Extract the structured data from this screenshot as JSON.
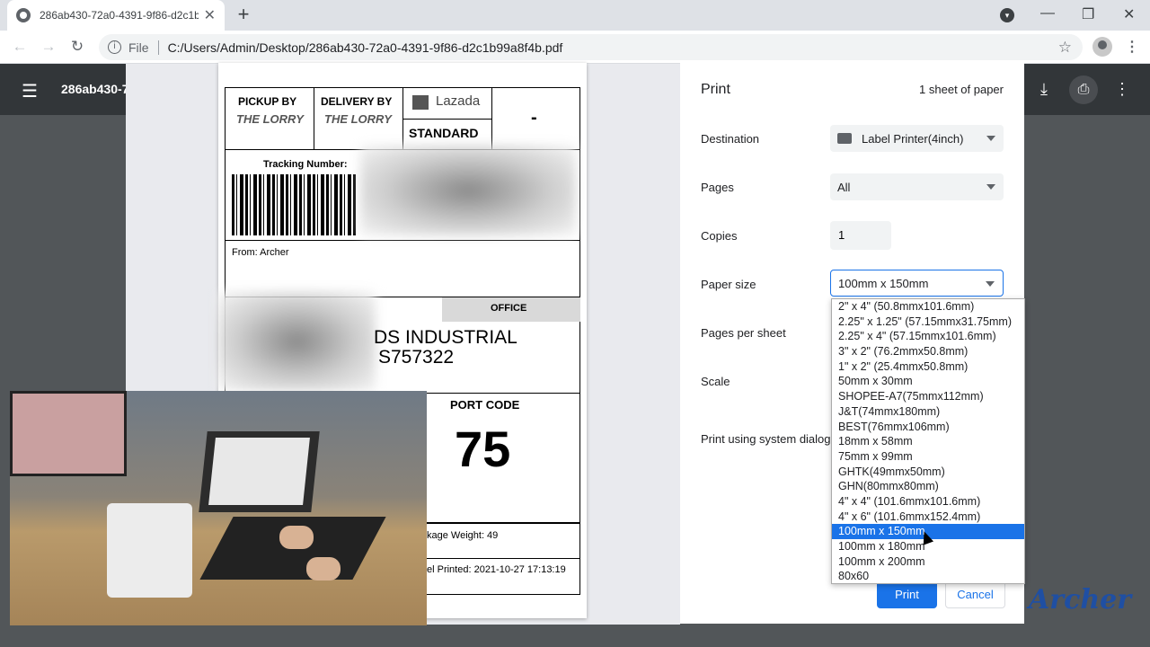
{
  "browser": {
    "tab_title": "286ab430-72a0-4391-9f86-d2c1b99a8f4b.pdf",
    "address_prefix": "File",
    "address": "C:/Users/Admin/Desktop/286ab430-72a0-4391-9f86-d2c1b99a8f4b.pdf"
  },
  "pdf_viewer": {
    "filename": "286ab430-7"
  },
  "label": {
    "pickup_by": "PICKUP BY",
    "delivery_by": "DELIVERY BY",
    "lorry_logo": "THE LORRY",
    "lazada": "Lazada",
    "standard": "STANDARD",
    "dash": "-",
    "tracking": "Tracking Number:",
    "from": "From: Archer",
    "office": "OFFICE",
    "addr1": "DS INDUSTRIAL",
    "addr2": "S757322",
    "port_code_label": "PORT CODE",
    "port_code": "75",
    "weight": "kage Weight: 49",
    "printed": "el Printed: 2021-10-27 17:13:19"
  },
  "dialog": {
    "title": "Print",
    "sheets": "1 sheet of paper",
    "destination_label": "Destination",
    "destination": "Label Printer(4inch)",
    "pages_label": "Pages",
    "pages": "All",
    "copies_label": "Copies",
    "copies": "1",
    "paper_label": "Paper size",
    "paper": "100mm x 150mm",
    "pps_label": "Pages per sheet",
    "scale_label": "Scale",
    "system_label": "Print using system dialog",
    "print_btn": "Print",
    "cancel_btn": "Cancel"
  },
  "paper_options": [
    "2\" x 4\" (50.8mmx101.6mm)",
    "2.25\" x 1.25\" (57.15mmx31.75mm)",
    "2.25\" x 4\" (57.15mmx101.6mm)",
    "3\" x 2\" (76.2mmx50.8mm)",
    "1\" x 2\" (25.4mmx50.8mm)",
    "50mm x 30mm",
    "SHOPEE-A7(75mmx112mm)",
    "J&T(74mmx180mm)",
    "BEST(76mmx106mm)",
    "18mm x 58mm",
    "75mm x 99mm",
    "GHTK(49mmx50mm)",
    "GHN(80mmx80mm)",
    "4\" x 4\" (101.6mmx101.6mm)",
    "4\" x 6\" (101.6mmx152.4mm)",
    "100mm x 150mm",
    "100mm x 180mm",
    "100mm x 200mm",
    "80x60"
  ],
  "selected_option_index": 15,
  "watermark": "Archer",
  "colors": {
    "accent": "#1a73e8",
    "pdf_bar": "#323639"
  }
}
